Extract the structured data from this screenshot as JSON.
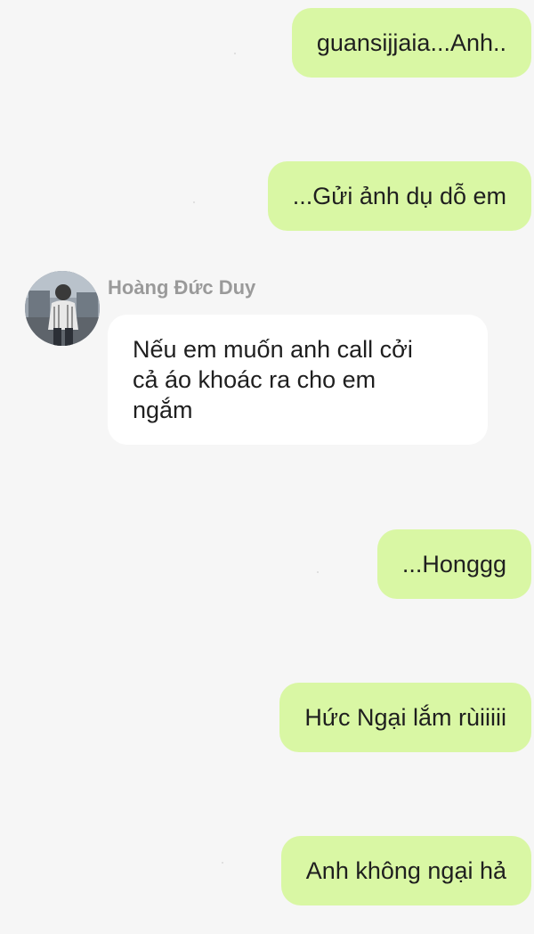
{
  "colors": {
    "background": "#f6f6f6",
    "sent_bubble": "#d9f7a4",
    "received_bubble": "#ffffff",
    "sender_name": "#9a9a9a"
  },
  "messages": [
    {
      "direction": "sent",
      "text": "guansijjaia...Anh.."
    },
    {
      "direction": "sent",
      "text": "...Gửi ảnh dụ dỗ em"
    },
    {
      "direction": "received",
      "sender": "Hoàng Đức Duy",
      "avatar_icon": "user-avatar-photo",
      "lines": [
        "Nếu em muốn anh call cởi",
        "cả áo khoác ra cho em",
        "ngắm"
      ]
    },
    {
      "direction": "sent",
      "text": "...Honggg"
    },
    {
      "direction": "sent",
      "text": "Hức Ngại lắm rùiiiii"
    },
    {
      "direction": "sent",
      "text": "Anh không ngại hả"
    }
  ]
}
